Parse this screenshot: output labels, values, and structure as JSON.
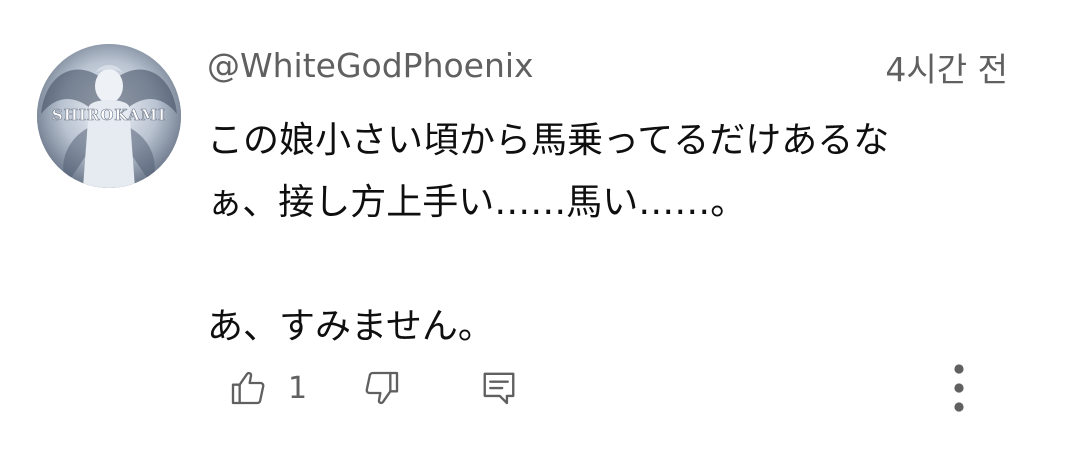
{
  "comment": {
    "author": "@WhiteGodPhoenix",
    "timestamp": "4시간 전",
    "avatar_text": "SHIROKAMI",
    "lines": [
      "この娘小さい頃から馬乗ってるだけあるな",
      "ぁ、接し方上手い……馬い……。",
      "",
      "あ、すみません。"
    ],
    "like_count": "1"
  },
  "icons": {
    "like": "thumbs-up-icon",
    "dislike": "thumbs-down-icon",
    "reply": "reply-comment-icon",
    "more": "more-vertical-icon"
  },
  "colors": {
    "text_primary": "#0f0f0f",
    "text_secondary": "#606060",
    "background": "#ffffff"
  }
}
